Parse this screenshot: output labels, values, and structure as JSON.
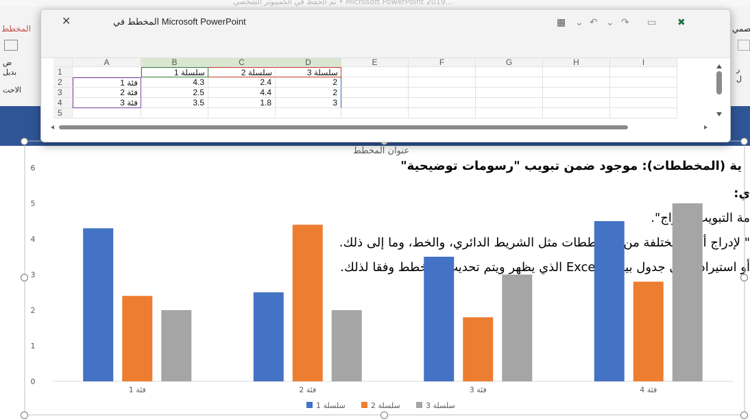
{
  "ppt": {
    "title_bar": "تم الحفظ في الكمبيوتر الشخصي • Microsoft PowerPoint 2019...",
    "left_tab": "المخطط",
    "left_ribbon_a": "ض",
    "left_ribbon_b": "بديل",
    "left_ribbon_c": "الاحت",
    "right_tab": "تصمي",
    "right_ribbon_a": "ر",
    "right_ribbon_b": "ل"
  },
  "excel": {
    "title": "المخطط في Microsoft PowerPoint",
    "close_label": "✕",
    "col_headers": [
      "A",
      "B",
      "C",
      "D",
      "E",
      "F",
      "G",
      "H",
      "I"
    ],
    "row_headers": [
      "1",
      "2",
      "3",
      "4",
      "5"
    ],
    "rows": [
      [
        "",
        "سلسلة 1",
        "سلسلة 2",
        "سلسلة 3"
      ],
      [
        "فئة 1",
        "4.3",
        "2.4",
        "2"
      ],
      [
        "فئة 2",
        "2.5",
        "4.4",
        "2"
      ],
      [
        "فئة 3",
        "3.5",
        "1.8",
        "3"
      ],
      [
        "",
        "",
        "",
        ""
      ]
    ]
  },
  "doc": {
    "line1": "ية (المخططات): موجود ضمن تبويب \"رسومات توضيحية\"",
    "line2": "ي:",
    "line3": "مة التبويب \"إدراج\".",
    "line4": "\" لإدراج أنواع مختلفة من المخططات مثل الشريط الدائري، والخط، وما إلى ذلك.",
    "line5": "أو استيرادها في جدول بيانات Excel الذي يظهر ويتم تحديث المخطط وفقا لذلك."
  },
  "chart_data": {
    "type": "bar",
    "title": "عنوان المخطط",
    "categories": [
      "فئة 1",
      "فئة 2",
      "فئة 3",
      "فئة 4"
    ],
    "series": [
      {
        "name": "سلسلة 1",
        "values": [
          4.3,
          2.5,
          3.5,
          4.5
        ],
        "color": "#4472c4"
      },
      {
        "name": "سلسلة 2",
        "values": [
          2.4,
          4.4,
          1.8,
          2.8
        ],
        "color": "#ed7d31"
      },
      {
        "name": "سلسلة 3",
        "values": [
          2,
          2,
          3,
          5
        ],
        "color": "#a5a5a5"
      }
    ],
    "ylim": [
      0,
      6
    ],
    "yticks": [
      "0",
      "1",
      "2",
      "3",
      "4",
      "5",
      "6"
    ],
    "grid": false,
    "legend": "bottom"
  }
}
